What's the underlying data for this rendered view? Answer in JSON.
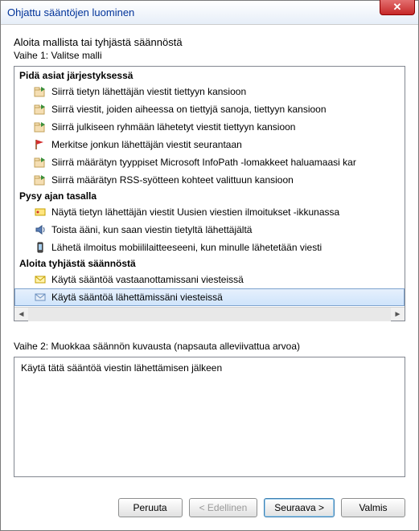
{
  "window": {
    "title": "Ohjattu sääntöjen luominen"
  },
  "intro": "Aloita mallista tai tyhjästä säännöstä",
  "step1_label": "Vaihe 1: Valitse malli",
  "groups": {
    "g1": {
      "header": "Pidä asiat järjestyksessä",
      "items": [
        "Siirrä tietyn lähettäjän viestit tiettyyn kansioon",
        "Siirrä viestit, joiden aiheessa on tiettyjä sanoja, tiettyyn kansioon",
        "Siirrä julkiseen ryhmään lähetetyt viestit tiettyyn kansioon",
        "Merkitse jonkun lähettäjän viestit seurantaan",
        "Siirrä määrätyn tyyppiset Microsoft InfoPath -lomakkeet haluamaasi kar",
        "Siirrä määrätyn RSS-syötteen kohteet valittuun kansioon"
      ]
    },
    "g2": {
      "header": "Pysy ajan tasalla",
      "items": [
        "Näytä tietyn lähettäjän viestit Uusien viestien ilmoitukset -ikkunassa",
        "Toista ääni, kun saan viestin tietyltä lähettäjältä",
        "Lähetä ilmoitus mobiililaitteeseeni, kun minulle lähetetään viesti"
      ]
    },
    "g3": {
      "header": "Aloita tyhjästä säännöstä",
      "items": [
        "Käytä sääntöä vastaanottamissani viesteissä",
        "Käytä sääntöä lähettämissäni viesteissä"
      ]
    }
  },
  "step2_label": "Vaihe 2: Muokkaa säännön kuvausta (napsauta alleviivattua arvoa)",
  "description": "Käytä tätä sääntöä viestin lähettämisen jälkeen",
  "buttons": {
    "cancel": "Peruuta",
    "back": "< Edellinen",
    "next": "Seuraava >",
    "finish": "Valmis"
  }
}
